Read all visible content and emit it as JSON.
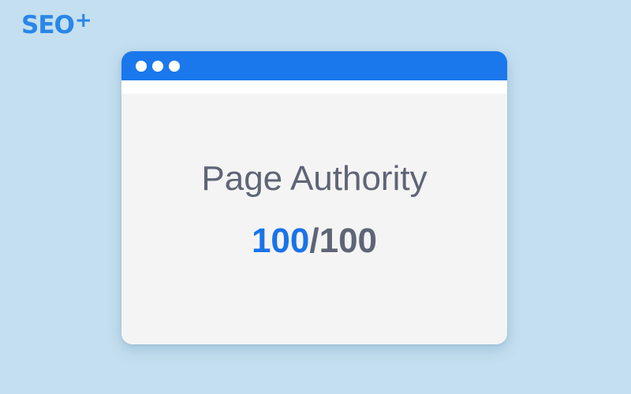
{
  "logo": {
    "text": "SEO",
    "superscript": "+",
    "color": "#2a86e8"
  },
  "window": {
    "titlebar_color": "#1a78ec",
    "controls": [
      "window-dot",
      "window-dot",
      "window-dot"
    ]
  },
  "main": {
    "heading": "Page Authority",
    "score": {
      "value": "100",
      "separator": "/",
      "max": "100",
      "value_color": "#1a73e8",
      "text_color": "#5f6575"
    }
  },
  "background_color": "#c4dfef"
}
